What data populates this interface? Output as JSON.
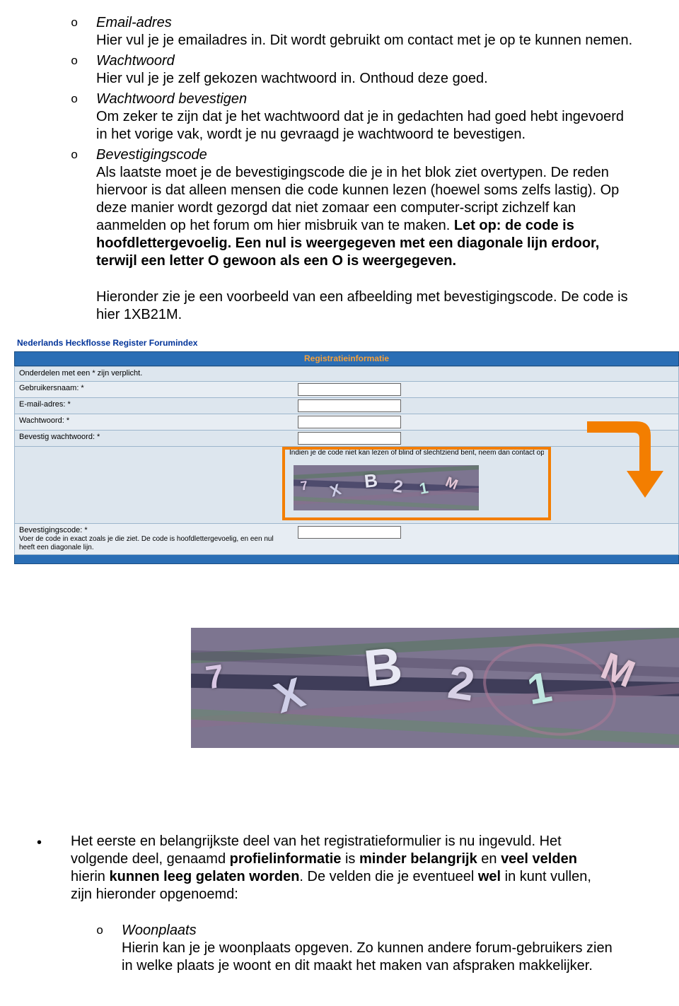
{
  "items": {
    "email": {
      "title": "Email-adres",
      "body": "Hier vul je je emailadres in. Dit wordt gebruikt om contact met je op te kunnen nemen."
    },
    "pw": {
      "title": "Wachtwoord",
      "body": "Hier vul je je zelf gekozen wachtwoord in. Onthoud deze goed."
    },
    "pwc": {
      "title": "Wachtwoord bevestigen",
      "body": "Om zeker te zijn dat je het wachtwoord dat je in gedachten had goed hebt ingevoerd in het vorige vak, wordt je nu gevraagd je wachtwoord te bevestigen."
    },
    "code": {
      "title": "Bevestigingscode",
      "body1": "Als laatste moet je de bevestigingscode die je in het blok ziet overtypen. De reden hiervoor is dat alleen mensen die code kunnen lezen (hoewel soms zelfs lastig). Op deze manier wordt gezorgd dat niet zomaar een computer-script zichzelf kan aanmelden op het forum om hier misbruik van te maken. ",
      "body_bold": "Let op: de code is hoofdlettergevoelig. Een nul is weergegeven met een diagonale lijn erdoor, terwijl een letter O gewoon als een O is weergegeven.",
      "body2a": "Hieronder zie je een voorbeeld van een afbeelding met bevestigingscode. De code is hier 1XB21M."
    }
  },
  "bullet_o": "o",
  "shot": {
    "indexlink": "Nederlands Heckflosse Register Forumindex",
    "bar_title": "Registratieinformatie",
    "required_hint": "Onderdelen met een * zijn verplicht.",
    "rows": {
      "user": "Gebruikersnaam: *",
      "email": "E-mail-adres: *",
      "pw": "Wachtwoord: *",
      "pwc": "Bevestig wachtwoord: *"
    },
    "captcha_hint": "Indien je de code niet kan lezen of blind of slechtziend bent, neem dan contact op met de Administrator",
    "conf_label": "Bevestigingscode: *",
    "conf_sub": "Voer de code in exact zoals je die ziet. De code is hoofdlettergevoelig, en een nul heeft een diagonale lijn."
  },
  "captcha_chars": [
    "7",
    "X",
    "B",
    "2",
    "1",
    "M"
  ],
  "lower": {
    "p1a": "Het eerste en belangrijkste deel van het registratieformulier is nu ingevuld. Het volgende deel, genaamd ",
    "p1b": "profielinformatie",
    "p1c": " is ",
    "p1d": "minder belangrijk",
    "p1e": " en ",
    "p1f": "veel velden",
    "p1g": " hierin ",
    "p1h": "kunnen leeg gelaten worden",
    "p1i": ". De velden die je eventueel ",
    "p1j": "wel",
    "p1k": " in kunt vullen, zijn hieronder opgenoemd:",
    "woon_title": "Woonplaats",
    "woon_body": "Hierin kan je je woonplaats opgeven. Zo kunnen andere forum-gebruikers zien in welke plaats je woont en dit maakt het maken van afspraken makkelijker."
  },
  "dot": "•"
}
